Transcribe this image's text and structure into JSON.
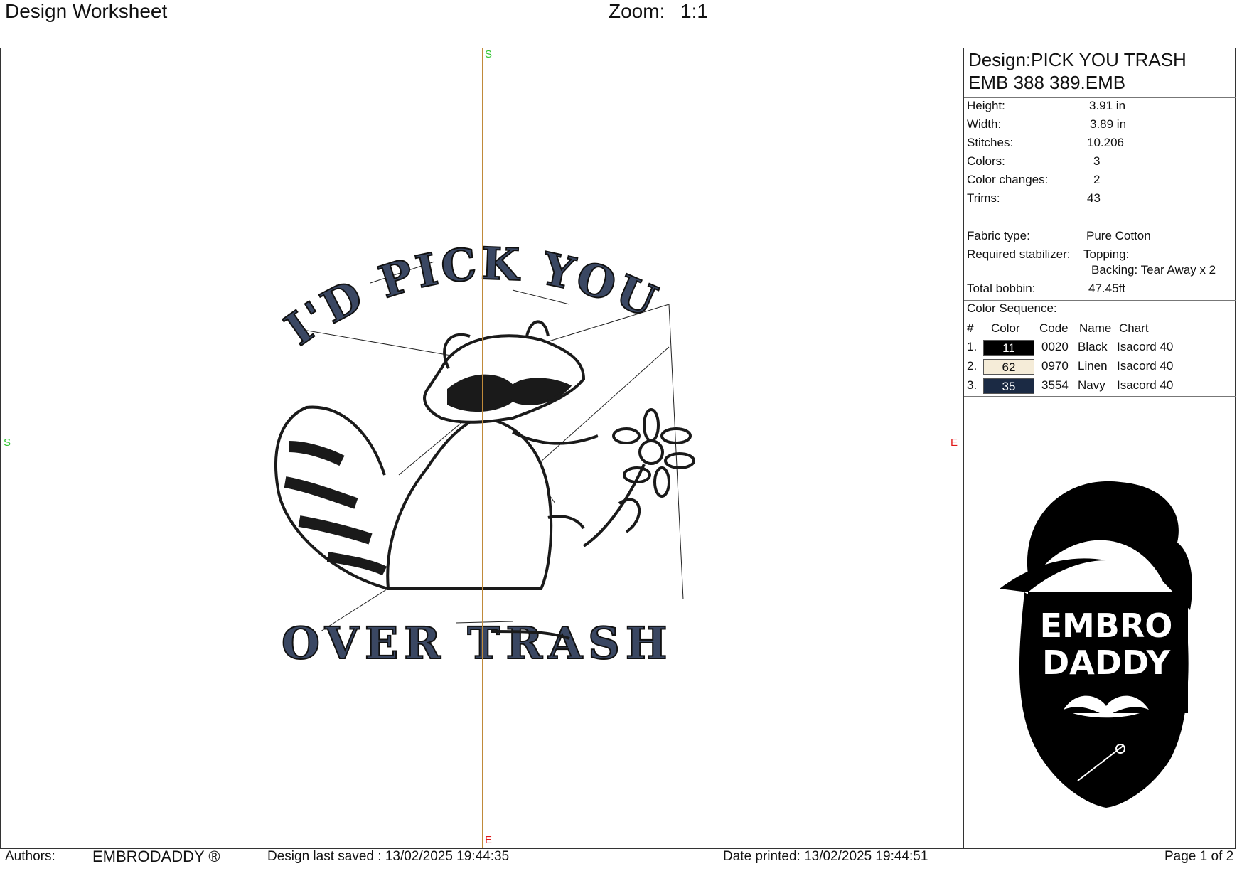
{
  "header": {
    "title": "Design Worksheet",
    "zoom_label": "Zoom:",
    "zoom_value": "1:1"
  },
  "canvas": {
    "axis_start_marker": "S",
    "axis_end_marker": "E",
    "design_text_top": "I'D PICK YOU",
    "design_text_bottom": "OVER TRASH"
  },
  "panel": {
    "design_name": "Design:PICK YOU TRASH",
    "file_name": "EMB 388 389.EMB",
    "specs": [
      {
        "label": "Height:",
        "value": "3.91 in"
      },
      {
        "label": "Width:",
        "value": "3.89 in"
      },
      {
        "label": "Stitches:",
        "value": "10.206"
      },
      {
        "label": "Colors:",
        "value": "3"
      },
      {
        "label": "Color changes:",
        "value": "2"
      },
      {
        "label": "Trims:",
        "value": "43"
      }
    ],
    "fabric_label": "Fabric type:",
    "fabric_value": "Pure Cotton",
    "stabilizer_label": "Required stabilizer:",
    "stabilizer_topping": "Topping:",
    "stabilizer_backing": "Backing: Tear Away x 2",
    "bobbin_label": "Total bobbin:",
    "bobbin_value": "47.45ft",
    "sequence_title": "Color Sequence:",
    "sequence_headers": {
      "num": "#",
      "color": "Color",
      "code": "Code",
      "name": "Name",
      "chart": "Chart"
    },
    "sequence": [
      {
        "num": "1.",
        "color_no": "11",
        "code": "0020",
        "name": "Black",
        "chart": "Isacord 40",
        "swatch": "#000000",
        "text_color": "#ffffff"
      },
      {
        "num": "2.",
        "color_no": "62",
        "code": "0970",
        "name": "Linen",
        "chart": "Isacord 40",
        "swatch": "#f5ecd8",
        "text_color": "#111111"
      },
      {
        "num": "3.",
        "color_no": "35",
        "code": "3554",
        "name": "Navy",
        "chart": "Isacord 40",
        "swatch": "#1b2a44",
        "text_color": "#ffffff"
      }
    ],
    "logo_line1": "EMBRO",
    "logo_line2": "DADDY"
  },
  "footer": {
    "authors_label": "Authors:",
    "authors_value": "EMBRODADDY ®",
    "saved": "Design last saved : 13/02/2025 19:44:35",
    "printed": "Date printed: 13/02/2025 19:44:51",
    "page": "Page 1 of 2"
  },
  "colors": {
    "axis": "#c08a3a",
    "stitch_navy": "#3a4762",
    "stitch_black": "#1a1a1a"
  }
}
